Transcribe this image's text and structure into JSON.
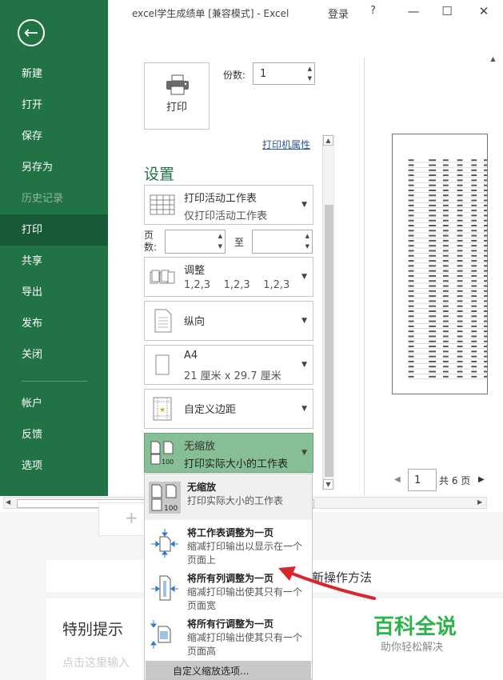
{
  "window": {
    "title": "excel学生成绩单 [兼容模式] - Excel",
    "login": "登录",
    "help": "?"
  },
  "sidebar": {
    "items": [
      {
        "label": "新建"
      },
      {
        "label": "打开"
      },
      {
        "label": "保存"
      },
      {
        "label": "另存为"
      },
      {
        "label": "历史记录"
      },
      {
        "label": "打印"
      },
      {
        "label": "共享"
      },
      {
        "label": "导出"
      },
      {
        "label": "发布"
      },
      {
        "label": "关闭"
      },
      {
        "label": "帐户"
      },
      {
        "label": "反馈"
      },
      {
        "label": "选项"
      }
    ],
    "active": "打印",
    "disabled": "历史记录"
  },
  "print": {
    "button_label": "打印",
    "copies_label": "份数:",
    "copies_value": "1",
    "printer_properties": "打印机属性",
    "settings_title": "设置",
    "pages_label": "页数:",
    "to_label": "至"
  },
  "settings": [
    {
      "title": "打印活动工作表",
      "subtitle": "仅打印活动工作表",
      "icon": "sheet-grid-icon"
    },
    {
      "title": "调整",
      "subtitle": "1,2,3    1,2,3    1,2,3",
      "icon": "collate-icon"
    },
    {
      "title": "纵向",
      "subtitle": "",
      "icon": "portrait-icon"
    },
    {
      "title": "A4",
      "subtitle": "21 厘米 x 29.7 厘米",
      "icon": "paper-size-icon"
    },
    {
      "title": "自定义边距",
      "subtitle": "",
      "icon": "margins-icon"
    },
    {
      "title": "无缩放",
      "subtitle": "打印实际大小的工作表",
      "icon": "no-scaling-icon"
    }
  ],
  "scaling_options": [
    {
      "title": "无缩放",
      "desc": "打印实际大小的工作表"
    },
    {
      "title": "将工作表调整为一页",
      "desc": "缩减打印输出以显示在一个页面上"
    },
    {
      "title": "将所有列调整为一页",
      "desc": "缩减打印输出使其只有一个页面宽"
    },
    {
      "title": "将所有行调整为一页",
      "desc": "缩减打印输出使其只有一个页面高"
    }
  ],
  "custom_scaling": "自定义缩放选项...",
  "pager": {
    "current": "1",
    "total": "共 6 页"
  },
  "background": {
    "method_text": "新操作方法",
    "special_title": "特别提示",
    "hint": "点击这里输入"
  },
  "watermark": {
    "brand": "百科全说",
    "slogan": "助你轻松解决"
  },
  "colors": {
    "accent": "#217346",
    "selected": "#86bf95",
    "arrow": "#d9262b"
  }
}
